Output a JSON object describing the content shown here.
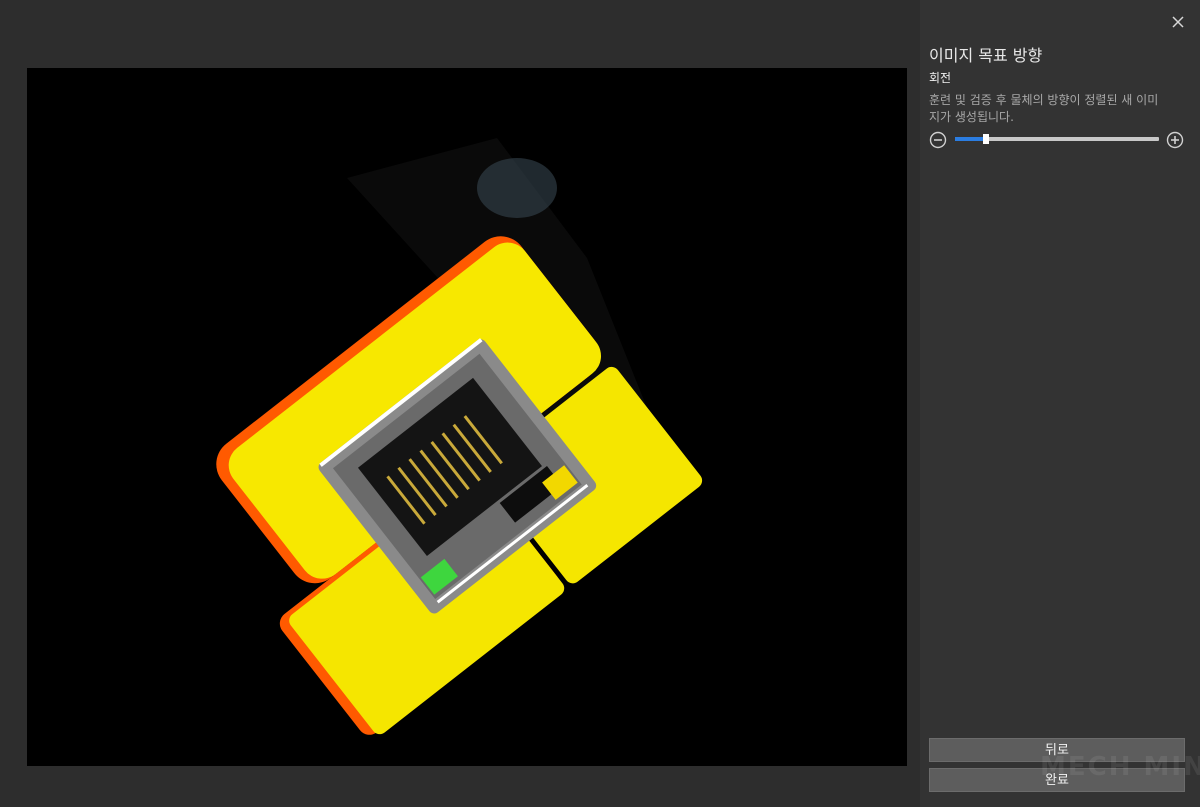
{
  "dialog": {
    "title": "이미지 목표 방향",
    "section_label": "회전",
    "description": "훈련 및 검증 후 물체의 방향이 정렬된 새 이미지가 생성됩니다.",
    "close_icon": "close-icon"
  },
  "rotation_slider": {
    "value_fraction": 0.15,
    "minus_icon": "zoom-out-icon",
    "plus_icon": "zoom-in-icon",
    "accent_color": "#2b7de1"
  },
  "buttons": {
    "back_label": "뒤로",
    "done_label": "완료"
  },
  "watermark": {
    "text": "MECH MIND"
  },
  "preview": {
    "description": "rotated image of RJ45 connector on yellow block",
    "colors": {
      "block": "#f5e600",
      "edge": "#ff5a00",
      "metal": "#8a8a8a",
      "led": "#3ed63e"
    }
  }
}
